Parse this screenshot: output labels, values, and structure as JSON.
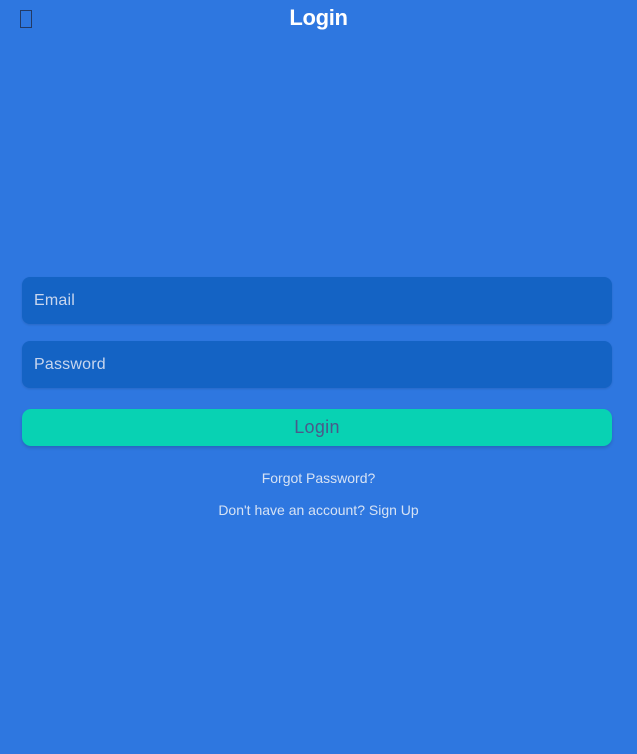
{
  "header": {
    "back_icon": "back-icon",
    "title": "Login"
  },
  "form": {
    "email": {
      "placeholder": "Email",
      "value": ""
    },
    "password": {
      "placeholder": "Password",
      "value": ""
    },
    "login_label": "Login"
  },
  "links": {
    "forgot_password": "Forgot Password?",
    "signup_prompt": "Don't have an account? Sign Up"
  },
  "colors": {
    "background": "#2e77e0",
    "field_bg": "#1463c4",
    "button_bg": "#08d2b3",
    "button_text": "#4a5a8a"
  }
}
